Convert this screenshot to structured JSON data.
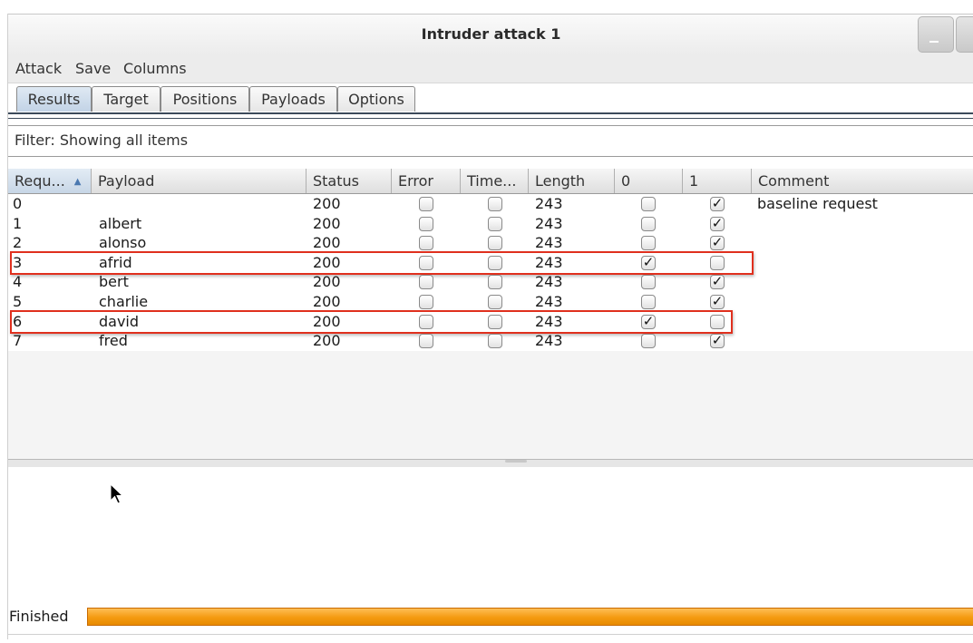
{
  "window": {
    "title": "Intruder attack 1"
  },
  "menu": [
    "Attack",
    "Save",
    "Columns"
  ],
  "tabs": [
    {
      "label": "Results",
      "active": true
    },
    {
      "label": "Target",
      "active": false
    },
    {
      "label": "Positions",
      "active": false
    },
    {
      "label": "Payloads",
      "active": false
    },
    {
      "label": "Options",
      "active": false
    }
  ],
  "filter": {
    "text": "Filter: Showing all items"
  },
  "table": {
    "columns": [
      "Requ...",
      "Payload",
      "Status",
      "Error",
      "Time...",
      "Length",
      "0",
      "1",
      "Comment"
    ],
    "sorted_column": "Requ...",
    "rows": [
      {
        "request": "0",
        "payload": "",
        "status": "200",
        "error": false,
        "timeout": false,
        "length": "243",
        "m0": false,
        "m1": true,
        "comment": "baseline request",
        "highlighted": false
      },
      {
        "request": "1",
        "payload": "albert",
        "status": "200",
        "error": false,
        "timeout": false,
        "length": "243",
        "m0": false,
        "m1": true,
        "comment": "",
        "highlighted": false
      },
      {
        "request": "2",
        "payload": "alonso",
        "status": "200",
        "error": false,
        "timeout": false,
        "length": "243",
        "m0": false,
        "m1": true,
        "comment": "",
        "highlighted": false
      },
      {
        "request": "3",
        "payload": "afrid",
        "status": "200",
        "error": false,
        "timeout": false,
        "length": "243",
        "m0": true,
        "m1": false,
        "comment": "",
        "highlighted": true
      },
      {
        "request": "4",
        "payload": "bert",
        "status": "200",
        "error": false,
        "timeout": false,
        "length": "243",
        "m0": false,
        "m1": true,
        "comment": "",
        "highlighted": false
      },
      {
        "request": "5",
        "payload": "charlie",
        "status": "200",
        "error": false,
        "timeout": false,
        "length": "243",
        "m0": false,
        "m1": true,
        "comment": "",
        "highlighted": false
      },
      {
        "request": "6",
        "payload": "david",
        "status": "200",
        "error": false,
        "timeout": false,
        "length": "243",
        "m0": true,
        "m1": false,
        "comment": "",
        "highlighted": true
      },
      {
        "request": "7",
        "payload": "fred",
        "status": "200",
        "error": false,
        "timeout": false,
        "length": "243",
        "m0": false,
        "m1": true,
        "comment": "",
        "highlighted": false
      }
    ]
  },
  "status": {
    "label": "Finished",
    "progress": 1.0
  },
  "colors": {
    "highlight": "#e0301e",
    "progress": "#f49a10",
    "active_tab": "#c2d3e6"
  },
  "icons": {
    "sort": "sort-ascending-icon",
    "cursor": "mouse-pointer-icon",
    "check": "checkmark-icon"
  }
}
